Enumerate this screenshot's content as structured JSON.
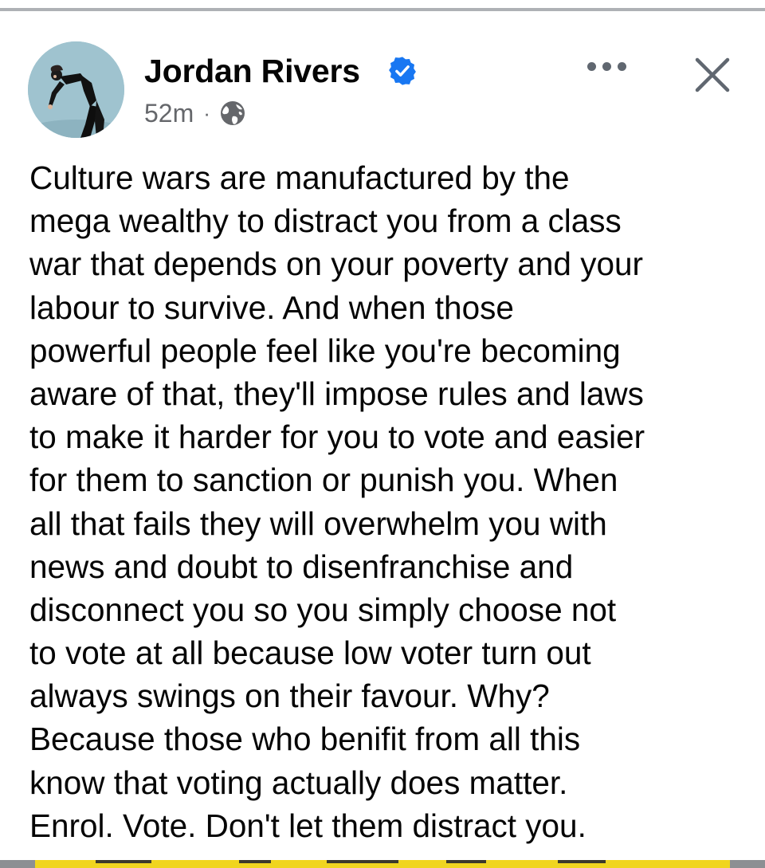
{
  "post": {
    "author": "Jordan Rivers",
    "verified": true,
    "timestamp": "52m",
    "separator": "·",
    "audience_icon": "globe-icon",
    "more_icon": "more-horizontal-icon",
    "close_icon": "close-icon",
    "lines": [
      "Culture wars are manufactured by the",
      "mega wealthy to distract you from a class",
      "war that depends on your poverty and your",
      "labour to survive. And when those",
      "powerful people feel like you're becoming",
      "aware of that, they'll impose rules and laws",
      "to make it harder for you to vote and easier",
      "for them to sanction or punish you. When",
      "all that fails they will overwhelm you with",
      "news and doubt to disenfranchise and",
      "disconnect you so you simply choose not",
      "to vote at all because low voter turn out",
      "always swings on their favour. Why?",
      "Because those who benifit from all this",
      "know that voting actually does matter.",
      "Enrol. Vote. Don't let them distract you."
    ]
  },
  "colors": {
    "verified_badge": "#1877f2",
    "meta_text": "#65676b",
    "primary_text": "#050505",
    "icon_gray": "#606770"
  }
}
